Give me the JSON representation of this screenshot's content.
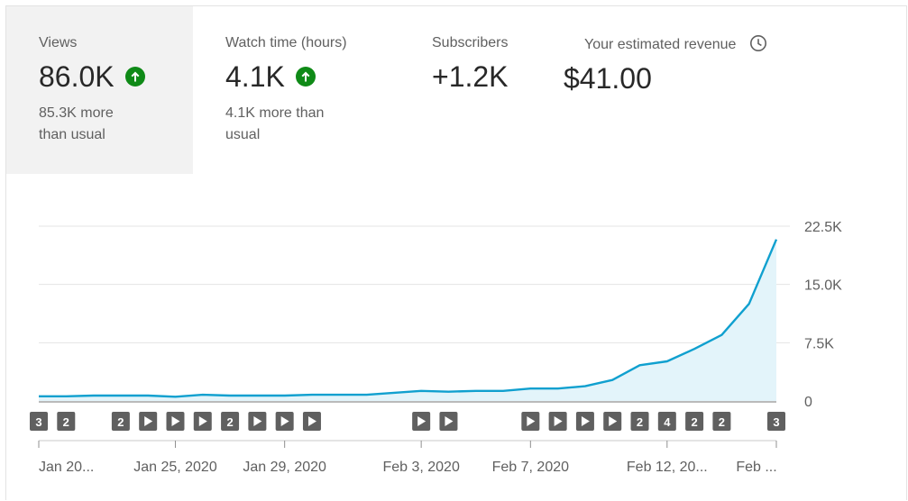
{
  "metrics": [
    {
      "label": "Views",
      "value": "86.0K",
      "note_line1": "85.3K more",
      "note_line2": "than usual",
      "trend_icon": "arrow-up-circle-icon"
    },
    {
      "label": "Watch time (hours)",
      "value": "4.1K",
      "note_line1": "4.1K more than",
      "note_line2": "usual",
      "trend_icon": "arrow-up-circle-icon"
    },
    {
      "label": "Subscribers",
      "value": "+1.2K"
    },
    {
      "label": "Your estimated revenue",
      "value": "$41.00",
      "info_icon": "clock-icon"
    }
  ],
  "colors": {
    "line": "#10a0cf",
    "area": "#e3f4fa",
    "up": "#0f8a17",
    "marker": "#606060",
    "grid": "#e5e5e5",
    "selected_bg": "#f2f2f2"
  },
  "chart_data": {
    "type": "area",
    "ylim": [
      0,
      22500
    ],
    "yticks": [
      "0",
      "7.5K",
      "15.0K",
      "22.5K"
    ],
    "ytick_values": [
      0,
      7500,
      15000,
      22500
    ],
    "x_labels": [
      "Jan 20...",
      "Jan 25, 2020",
      "Jan 29, 2020",
      "Feb 3, 2020",
      "Feb 7, 2020",
      "Feb 12, 20...",
      "Feb ..."
    ],
    "x_label_index": [
      0,
      5,
      9,
      14,
      18,
      23,
      27
    ],
    "series": [
      {
        "values": [
          600,
          600,
          700,
          700,
          700,
          550,
          800,
          700,
          700,
          700,
          800,
          800,
          800,
          1050,
          1300,
          1200,
          1300,
          1300,
          1600,
          1600,
          1900,
          2700,
          4600,
          5100,
          6700,
          8500,
          12500,
          20800
        ]
      }
    ],
    "markers": [
      "3",
      "2",
      "",
      "2",
      "▶",
      "▶",
      "▶",
      "2",
      "▶",
      "▶",
      "▶",
      "",
      "",
      "",
      "▶",
      "▶",
      "",
      "",
      "▶",
      "▶",
      "▶",
      "▶",
      "2",
      "4",
      "2",
      "2",
      "",
      "3"
    ]
  }
}
